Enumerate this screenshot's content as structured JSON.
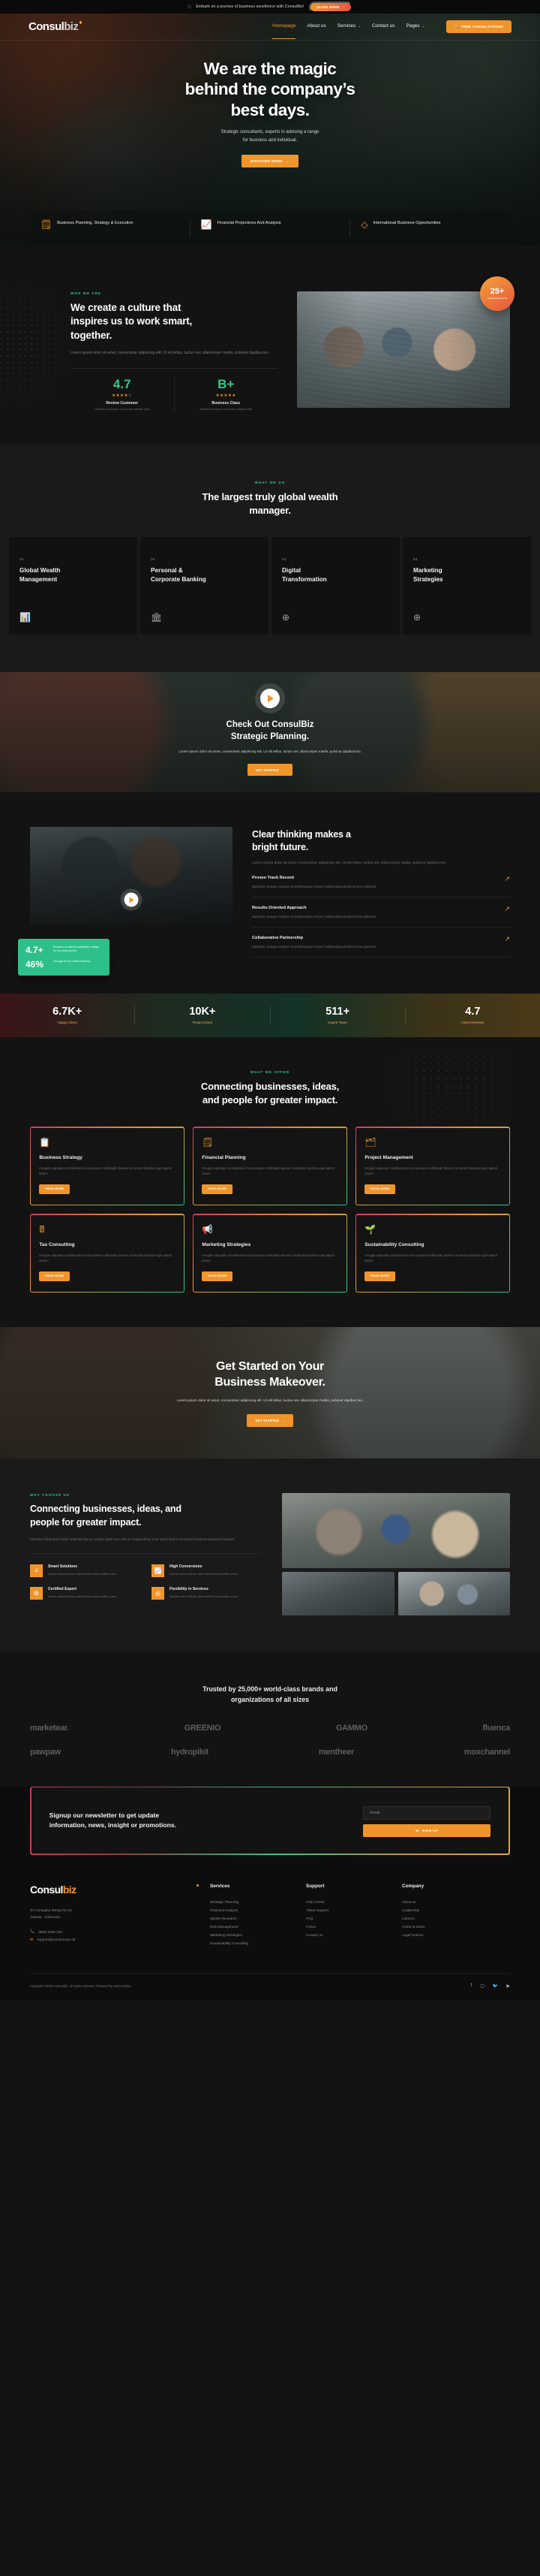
{
  "announcement": {
    "icon": "info-icon",
    "text": "Embark on a journey of business excellence with ConsulBiz!",
    "button": "LEARN MORE",
    "arrow": "→"
  },
  "header": {
    "logo_a": "Consul",
    "logo_b": "biz",
    "nav": [
      {
        "label": "Homepage",
        "caret": "",
        "active": true
      },
      {
        "label": "About us",
        "caret": "",
        "active": false
      },
      {
        "label": "Services",
        "caret": "⌄",
        "active": false
      },
      {
        "label": "Contact us",
        "caret": "",
        "active": false
      },
      {
        "label": "Pages",
        "caret": "⌄",
        "active": false
      }
    ],
    "cta": "FREE CONSULTATIONS",
    "cta_icon": "search-icon"
  },
  "hero": {
    "title_l1": "We are the magic",
    "title_l2": "behind the company’s",
    "title_l3": "best days.",
    "subtitle_l1": "Strategic consultants, experts in advising a range",
    "subtitle_l2": "for business and individual.",
    "button": "DISCOVER MORE",
    "button_arrow": "→",
    "features": [
      {
        "icon": "document-icon",
        "glyph": "὜E",
        "label": "Business Planning, Strategy & Execution"
      },
      {
        "icon": "chart-growth-icon",
        "glyph": "Ὄ8",
        "label": "Financial Projections And Analysis"
      },
      {
        "icon": "diamond-icon",
        "glyph": "◇",
        "label": "International Business Opportunities"
      }
    ]
  },
  "culture": {
    "eyebrow": "WHO WE ARE",
    "title_l1": "We create a culture that",
    "title_l2": "inspires us to work smart,",
    "title_l3": "together.",
    "lead": "Lorem ipsum dolor sit amet, consectetur adipiscing elit. Ut elit tellus, luctus nec ullamcorper mattis, pulvinar dapibus leo.",
    "stats": [
      {
        "value": "4.7",
        "stars_on": "★★★★",
        "stars_off": "★",
        "label": "Review Customer",
        "sub": "Thanklon because such even articles with"
      },
      {
        "value": "B+",
        "stars_on": "★★★★★",
        "stars_off": "",
        "label": "Business Class",
        "sub": "Another because such even articles with"
      }
    ],
    "badge_number": "25+",
    "badge_text": "Years of Experience"
  },
  "whatwedo": {
    "eyebrow": "WHAT WE DO",
    "title_l1": "The largest truly global wealth",
    "title_l2": "manager.",
    "cards": [
      {
        "no": "01",
        "title_l1": "Global Wealth",
        "title_l2": "Management",
        "icon": "chart-bars-icon",
        "glyph": "ὌA"
      },
      {
        "no": "02",
        "title_l1": "Personal &",
        "title_l2": "Corporate Banking",
        "icon": "bank-icon",
        "glyph": "ἽB"
      },
      {
        "no": "03",
        "title_l1": "Digital",
        "title_l2": "Transformation",
        "icon": "globe-network-icon",
        "glyph": "⊕"
      },
      {
        "no": "04",
        "title_l1": "Marketing",
        "title_l2": "Strategies",
        "icon": "target-icon",
        "glyph": "⊕"
      }
    ]
  },
  "video": {
    "play_icon": "play-icon",
    "title_l1": "Check Out ConsulBiz",
    "title_l2": "Strategic Planning.",
    "subtitle": "Lorem ipsum dolor sit amet, consectetur adipiscing elit. Ut elit tellus, luctus nec ullamcorper mattis, pulvinar dapibus leo.",
    "button": "GET STARTED",
    "button_arrow": "→"
  },
  "clear": {
    "title_l1": "Clear thinking makes a",
    "title_l2": "bright future.",
    "lead": "Lorem ipsum dolor sit amet, consectetur adipiscing elit. Ut elit tellus, luctus nec ullamcorper mattis, pulvinar dapibus leo.",
    "items": [
      {
        "title": "Proven Track Record",
        "desc": "Dignissim quisque tempus sit pellentesque tempor malesuada parturient lacus placerat",
        "arrow": "↗"
      },
      {
        "title": "Results-Oriented Approach",
        "desc": "Dignissim quisque tempus sit pellentesque tempor malesuada parturient lacus placerat",
        "arrow": "↗"
      },
      {
        "title": "Collaborative Partnership",
        "desc": "Dignissim quisque tempus sit pellentesque tempor malesuada parturient lacus placerat",
        "arrow": "↗"
      }
    ],
    "float": [
      {
        "value": "4.7+",
        "desc": "Business & customer satisfaction ratings for our yearly service"
      },
      {
        "value": "46%",
        "desc": "Average ROI for clients business"
      }
    ]
  },
  "stats": [
    {
      "number": "6.7K+",
      "label": "Happy Client"
    },
    {
      "number": "10K+",
      "label": "Project Done"
    },
    {
      "number": "511+",
      "label": "Expert Team"
    },
    {
      "number": "4.7",
      "label": "Client Reviews"
    }
  ],
  "offer": {
    "eyebrow": "WHAT WE OFFER",
    "title_l1": "Connecting businesses, ideas,",
    "title_l2": "and people for greater impact.",
    "cards": [
      {
        "icon": "presentation-icon",
        "glyph": "ὌB",
        "title": "Business Strategy",
        "desc": "Feugiat vulputate condimentum mus posuere sollicitudin laoreet commodo faucibus eget aptent ipsum",
        "button": "READ MORE"
      },
      {
        "icon": "document-lines-icon",
        "glyph": "὜E",
        "title": "Financial Planning",
        "desc": "Feugiat vulputate condimentum mus posuere sollicitudin laoreet commodo faucibus eget aptent ipsum",
        "button": "READ MORE"
      },
      {
        "icon": "folder-plus-icon",
        "glyph": "὜2",
        "title": "Project Management",
        "desc": "Feugiat vulputate condimentum mus posuere sollicitudin laoreet commodo faucibus eget aptent ipsum",
        "button": "READ MORE"
      },
      {
        "icon": "calculator-icon",
        "glyph": "὚9",
        "title": "Tax Consulting",
        "desc": "Feugiat vulputate condimentum mus posuere sollicitudin laoreet commodo faucibus eget aptent ipsum",
        "button": "READ MORE"
      },
      {
        "icon": "megaphone-icon",
        "glyph": "὎2",
        "title": "Marketing Strategies",
        "desc": "Feugiat vulputate condimentum mus posuere sollicitudin laoreet commodo faucibus eget aptent ipsum",
        "button": "READ MORE"
      },
      {
        "icon": "leaf-icon",
        "glyph": "ἳ1",
        "title": "Sustainability Consulting",
        "desc": "Feugiat vulputate condimentum mus posuere sollicitudin laoreet commodo faucibus eget aptent ipsum",
        "button": "READ MORE"
      }
    ]
  },
  "started": {
    "title_l1": "Get Started on Your",
    "title_l2": "Business Makeover.",
    "subtitle": "Lorem ipsum dolor sit amet, consectetur adipiscing elit. Ut elit tellus, luctus nec ullamcorper mattis, pulvinar dapibus leo.",
    "button": "GET STARTED",
    "button_arrow": "→"
  },
  "why": {
    "eyebrow": "WHY CHOOSE US",
    "title_l1": "Connecting businesses, ideas, and",
    "title_l2": "people for greater impact.",
    "lead": "Interdum bibendum tortor vehicula hac ac nostra class non. Est mi suspendisse ante tortor viverra dictumst maximus praesent semper.",
    "features": [
      {
        "icon": "layers-icon",
        "glyph": "≡",
        "title": "Smart Solutions",
        "desc": "Mauris metus finibus vitae facilisis lacus mattis purus"
      },
      {
        "icon": "chart-up-icon",
        "glyph": "Ὄ8",
        "title": "High Conversions",
        "desc": "Mauris metus finibus vitae facilisis lacus mattis purus"
      },
      {
        "icon": "certificate-icon",
        "glyph": "⚙",
        "title": "Certified Expert",
        "desc": "Mauris metus finibus vitae facilisis lacus mattis purus"
      },
      {
        "icon": "fingerprint-icon",
        "glyph": "◎",
        "title": "Flexibility in Services",
        "desc": "Mauris metus finibus vitae facilisis lacus mattis purus"
      }
    ]
  },
  "brands": {
    "title_l1": "Trusted by 25,000+ world-class brands and",
    "title_l2": "organizations of all sizes",
    "row1": [
      "marketear.",
      "GREENIO",
      "GAMMO",
      "fluenca"
    ],
    "row2": [
      "pawpaw",
      "hydropikit",
      "mentheer",
      "moxchannel"
    ]
  },
  "newsletter": {
    "title_l1": "Signup our newsletter to get update",
    "title_l2": "information, news, insight or promotions.",
    "placeholder": "Email",
    "button": "SIGN UP",
    "button_icon": "envelope-icon"
  },
  "footer": {
    "logo_a": "Consul",
    "logo_b": "biz",
    "address_l1": "Jln Cempaka Wangi No 22",
    "address_l2": "Jakarta - Indonesia",
    "phone": "(888) 4000 234",
    "email": "support@yourdomain.tld",
    "phone_icon": "phone-icon",
    "email_icon": "envelope-icon",
    "columns": [
      {
        "heading": "Services",
        "links": [
          "Strategic Planning",
          "Financial Analysis",
          "Market Research",
          "Risk Management",
          "Marketing Strategies",
          "Sustainability Consulting"
        ]
      },
      {
        "heading": "Support",
        "links": [
          "Help Center",
          "Ticket Support",
          "FAQ",
          "Forum",
          "Contact us"
        ]
      },
      {
        "heading": "Company",
        "links": [
          "About us",
          "Leadership",
          "Careers",
          "Article & News",
          "Legal Notices"
        ]
      }
    ],
    "copyright": "Copyright ©2024 consulbiz, All rights reserved. Powered by MozCreative.",
    "socials": [
      "facebook-icon",
      "instagram-icon",
      "twitter-icon",
      "youtube-icon"
    ],
    "social_glyphs": [
      "f",
      "▢",
      "ᴠ",
      "▶"
    ]
  },
  "colors": {
    "accent_orange": "#f0952b",
    "accent_green": "#34c98a",
    "accent_red": "#d6365c",
    "bg_dark": "#131313"
  }
}
